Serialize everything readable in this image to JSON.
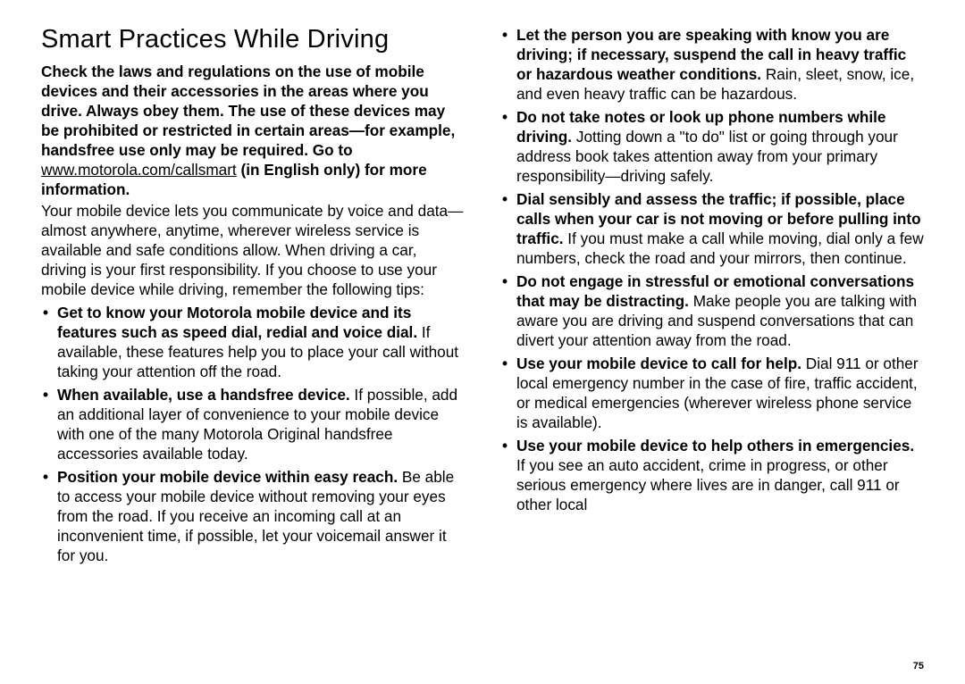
{
  "page_number": "75",
  "heading": "Smart Practices While Driving",
  "intro_bold_pre": "Check the laws and regulations on the use of mobile devices and their accessories in the areas where you drive. Always obey them. The use of these devices may be prohibited or restricted in certain areas—for example, handsfree use only may be required. Go to ",
  "intro_link_text": "www.motorola.com/callsmart",
  "intro_bold_post": " (in English only) for more information.",
  "body_para": "Your mobile device lets you communicate by voice and data—almost anywhere, anytime, wherever wireless service is available and safe conditions allow. When driving a car, driving is your first responsibility. If you choose to use your mobile device while driving, remember the following tips:",
  "left_bullets": [
    {
      "bold": "Get to know your Motorola mobile device and its features such as speed dial, redial and voice dial.",
      "rest": " If available, these features help you to place your call without taking your attention off the road."
    },
    {
      "bold": "When available, use a handsfree device.",
      "rest": " If possible, add an additional layer of convenience to your mobile device with one of the many Motorola Original handsfree accessories available today."
    },
    {
      "bold": "Position your mobile device within easy reach.",
      "rest": " Be able to access your mobile device without removing your eyes from the road. If you receive an incoming call at an inconvenient time, if possible, let your voicemail answer it for you."
    }
  ],
  "right_bullets": [
    {
      "bold": "Let the person you are speaking with know you are driving; if necessary, suspend the call in heavy traffic or hazardous weather conditions.",
      "rest": " Rain, sleet, snow, ice, and even heavy traffic can be hazardous."
    },
    {
      "bold": "Do not take notes or look up phone numbers while driving.",
      "rest": " Jotting down a \"to do\" list or going through your address book takes attention away from your primary responsibility—driving safely."
    },
    {
      "bold": "Dial sensibly and assess the traffic; if possible, place calls when your car is not moving or before pulling into traffic.",
      "rest": " If you must make a call while moving, dial only a few numbers, check the road and your mirrors, then continue."
    },
    {
      "bold": "Do not engage in stressful or emotional conversations that may be distracting.",
      "rest": " Make people you are talking with aware you are driving and suspend conversations that can divert your attention away from the road."
    },
    {
      "bold": "Use your mobile device to call for help.",
      "rest": " Dial 911 or other local emergency number in the case of fire, traffic accident, or medical emergencies (wherever wireless phone service is available)."
    },
    {
      "bold": "Use your mobile device to help others in emergencies.",
      "rest": " If you see an auto accident, crime in progress, or other serious emergency where lives are in danger, call 911 or other local"
    }
  ]
}
